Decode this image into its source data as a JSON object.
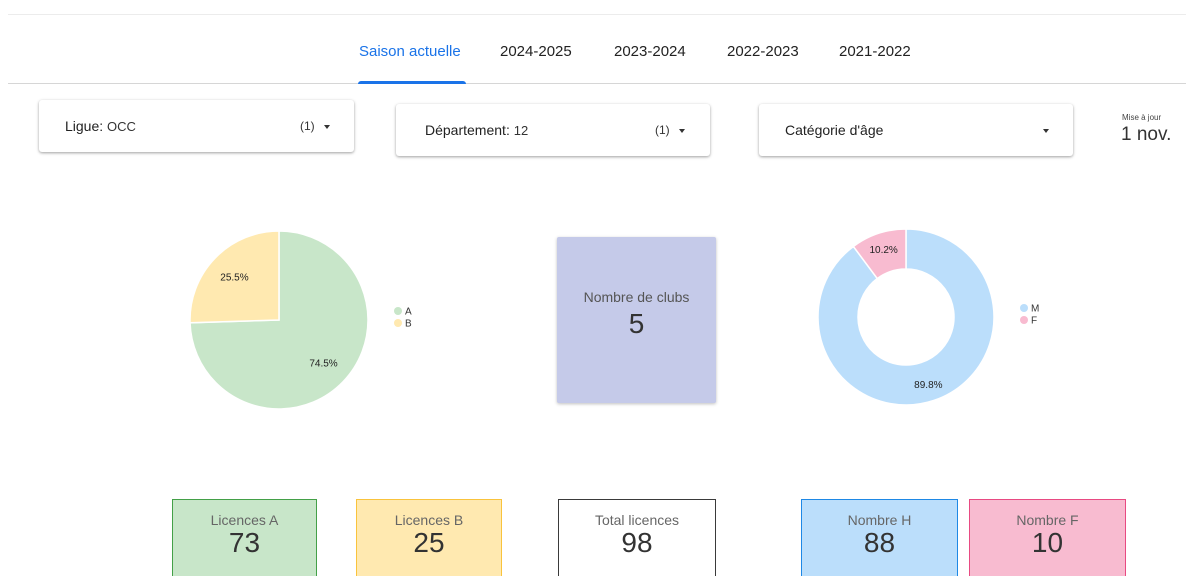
{
  "tabs": [
    {
      "label": "Saison actuelle",
      "active": true
    },
    {
      "label": "2024-2025",
      "active": false
    },
    {
      "label": "2023-2024",
      "active": false
    },
    {
      "label": "2022-2023",
      "active": false
    },
    {
      "label": "2021-2022",
      "active": false
    }
  ],
  "filters": {
    "ligue": {
      "label": "Ligue",
      "value": "OCC",
      "count": "(1)"
    },
    "departement": {
      "label": "Département",
      "value": "12",
      "count": "(1)"
    },
    "categorie": {
      "label": "Catégorie d'âge",
      "value": "",
      "count": ""
    }
  },
  "mise_a_jour": {
    "label": "Mise à jour",
    "value": "1 nov."
  },
  "clubs": {
    "label": "Nombre de clubs",
    "value": "5"
  },
  "kpis": {
    "licences_a": {
      "label": "Licences A",
      "value": "73"
    },
    "licences_b": {
      "label": "Licences B",
      "value": "25"
    },
    "total": {
      "label": "Total licences",
      "value": "98"
    },
    "nombre_h": {
      "label": "Nombre H",
      "value": "88"
    },
    "nombre_f": {
      "label": "Nombre F",
      "value": "10"
    }
  },
  "colors": {
    "accent": "#1a73e8",
    "licence_a": "#c8e6c9",
    "licence_b": "#ffe9b0",
    "male": "#bbdefb",
    "female": "#f8bbd0",
    "clubs": "#c5cae9"
  },
  "chart_data": [
    {
      "type": "pie",
      "categories": [
        "A",
        "B"
      ],
      "values": [
        74.5,
        25.5
      ],
      "labels": [
        "74.5%",
        "25.5%"
      ],
      "colors": [
        "#c8e6c9",
        "#ffe9b0"
      ],
      "legend": "right"
    },
    {
      "type": "pie",
      "donut": true,
      "categories": [
        "M",
        "F"
      ],
      "values": [
        89.8,
        10.2
      ],
      "labels": [
        "89.8%",
        "10.2%"
      ],
      "colors": [
        "#bbdefb",
        "#f8bbd0"
      ],
      "legend": "right"
    }
  ]
}
